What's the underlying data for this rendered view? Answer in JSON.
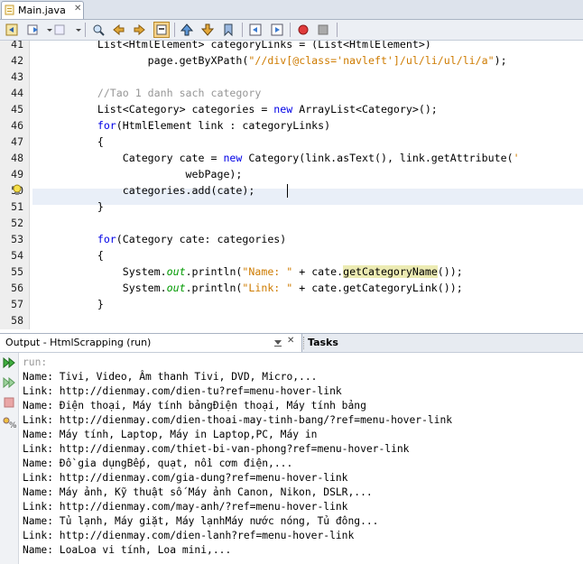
{
  "tab": {
    "title": "Main.java"
  },
  "editor": {
    "lines": [
      {
        "n": "41",
        "t": "        List<HtmlElement> categoryLinks = (List<HtmlElement>)"
      },
      {
        "n": "42",
        "t": ""
      },
      {
        "n": "43",
        "t": ""
      },
      {
        "n": "44",
        "t": ""
      },
      {
        "n": "45",
        "t": ""
      },
      {
        "n": "46",
        "t": ""
      },
      {
        "n": "47",
        "t": "        {"
      },
      {
        "n": "48",
        "t": ""
      },
      {
        "n": "49",
        "t": "                      webPage);"
      },
      {
        "n": "50",
        "t": ""
      },
      {
        "n": "51",
        "t": "        }"
      },
      {
        "n": "52",
        "t": ""
      },
      {
        "n": "53",
        "t": ""
      },
      {
        "n": "54",
        "t": "        {"
      },
      {
        "n": "55",
        "t": ""
      },
      {
        "n": "56",
        "t": ""
      },
      {
        "n": "57",
        "t": "        }"
      },
      {
        "n": "58",
        "t": ""
      }
    ],
    "tokens": {
      "l42a": "                page.getByXPath(",
      "l42b": "\"//div[@class='navleft']/ul/li/ul/li/a\"",
      "l42c": ");",
      "l44": "        //Tao 1 danh sach category",
      "l45a": "        List<Category> categories = ",
      "l45b": "new",
      "l45c": " ArrayList<Category>();",
      "l46a": "        ",
      "l46b": "for",
      "l46c": "(HtmlElement link : categoryLinks)",
      "l48a": "            Category cate = ",
      "l48b": "new",
      "l48c": " Category(link.asText(), link.getAttribute(",
      "l48d": "'",
      "l50": "            categories.add(cate);",
      "l53a": "        ",
      "l53b": "for",
      "l53c": "(Category cate: categories)",
      "l55a": "            System.",
      "l55b": "out",
      "l55c": ".println(",
      "l55d": "\"Name: \"",
      "l55e": " + cate.",
      "l55f": "getCategoryName",
      "l55g": "());",
      "l56a": "            System.",
      "l56b": "out",
      "l56c": ".println(",
      "l56d": "\"Link: \"",
      "l56e": " + cate.getCategoryLink());"
    }
  },
  "output": {
    "title": "Output - HtmlScrapping (run)",
    "tasks_title": "Tasks",
    "lines": [
      "run:",
      "Name: Tivi, Video, Âm thanh Tivi, DVD, Micro,...",
      "Link: http://dienmay.com/dien-tu?ref=menu-hover-link",
      "Name: Điện thoại, Máy tính bảngĐiện thoại, Máy tính bảng",
      "Link: http://dienmay.com/dien-thoai-may-tinh-bang/?ref=menu-hover-link",
      "Name: Máy tính, Laptop, Máy in Laptop,PC, Máy in",
      "Link: http://dienmay.com/thiet-bi-van-phong?ref=menu-hover-link",
      "Name: Đồ gia dụngBếp, quạt, nồi cơm điện,...",
      "Link: http://dienmay.com/gia-dung?ref=menu-hover-link",
      "Name: Máy ảnh, Kỹ thuật số Máy ảnh Canon, Nikon, DSLR,...",
      "Link: http://dienmay.com/may-anh/?ref=menu-hover-link",
      "Name: Tủ lạnh, Máy giặt, Máy lạnhMáy nước nóng, Tủ đông...",
      "Link: http://dienmay.com/dien-lanh?ref=menu-hover-link",
      "Name: LoaLoa vi tính, Loa mini,..."
    ]
  },
  "colors": {
    "keyword": "#0000e6",
    "string": "#ce7b00",
    "comment": "#969696",
    "field": "#009900",
    "highlight": "#ecebb3"
  }
}
